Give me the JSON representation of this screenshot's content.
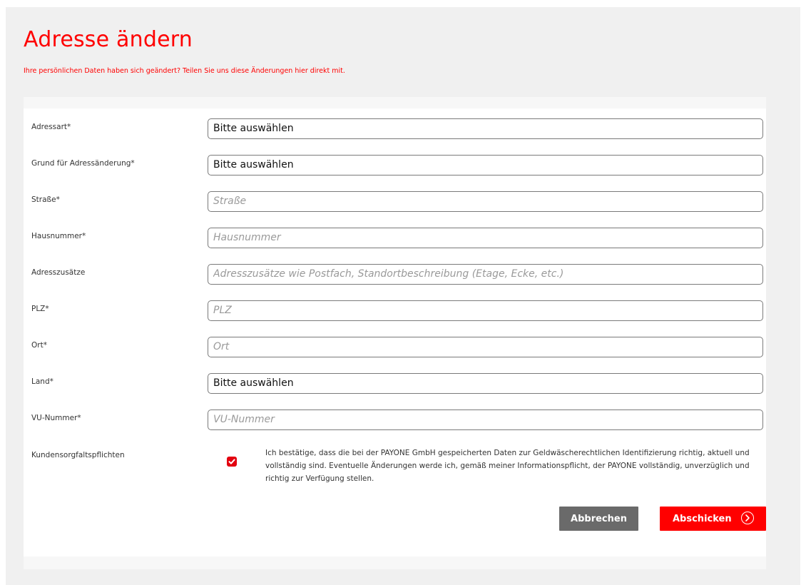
{
  "page": {
    "title": "Adresse ändern",
    "subtitle": "Ihre persönlichen Daten haben sich geändert? Teilen Sie uns diese Änderungen hier direkt mit."
  },
  "form": {
    "fields": [
      {
        "label": "Adressart*",
        "type": "select",
        "value": "Bitte auswählen"
      },
      {
        "label": "Grund für Adressänderung*",
        "type": "select",
        "value": "Bitte auswählen"
      },
      {
        "label": "Straße*",
        "type": "text",
        "placeholder": "Straße"
      },
      {
        "label": "Hausnummer*",
        "type": "text",
        "placeholder": "Hausnummer"
      },
      {
        "label": "Adresszusätze",
        "type": "text",
        "placeholder": "Adresszusätze wie Postfach, Standortbeschreibung (Etage, Ecke, etc.)"
      },
      {
        "label": "PLZ*",
        "type": "text",
        "placeholder": "PLZ"
      },
      {
        "label": "Ort*",
        "type": "text",
        "placeholder": "Ort"
      },
      {
        "label": "Land*",
        "type": "select",
        "value": "Bitte auswählen"
      },
      {
        "label": "VU-Nummer*",
        "type": "text",
        "placeholder": "VU-Nummer"
      }
    ],
    "consent": {
      "label": "Kundensorgfaltspflichten",
      "checked": true,
      "text": "Ich bestätige, dass die bei der PAYONE GmbH gespeicherten Daten zur Geldwäscherechtlichen Identifizierung richtig, aktuell und vollständig sind. Eventuelle Änderungen werde ich, gemäß meiner Informationspflicht, der PAYONE vollständig, unverzüglich und richtig zur Verfügung stellen.",
      "icon": "checkmark-icon"
    },
    "buttons": {
      "cancel_label": "Abbrechen",
      "submit_label": "Abschicken",
      "submit_icon": "arrow-right-circle-icon"
    }
  },
  "colors": {
    "accent": "#ff0000",
    "cancel_button": "#6a6a6a",
    "background": "#f0f0f0"
  }
}
